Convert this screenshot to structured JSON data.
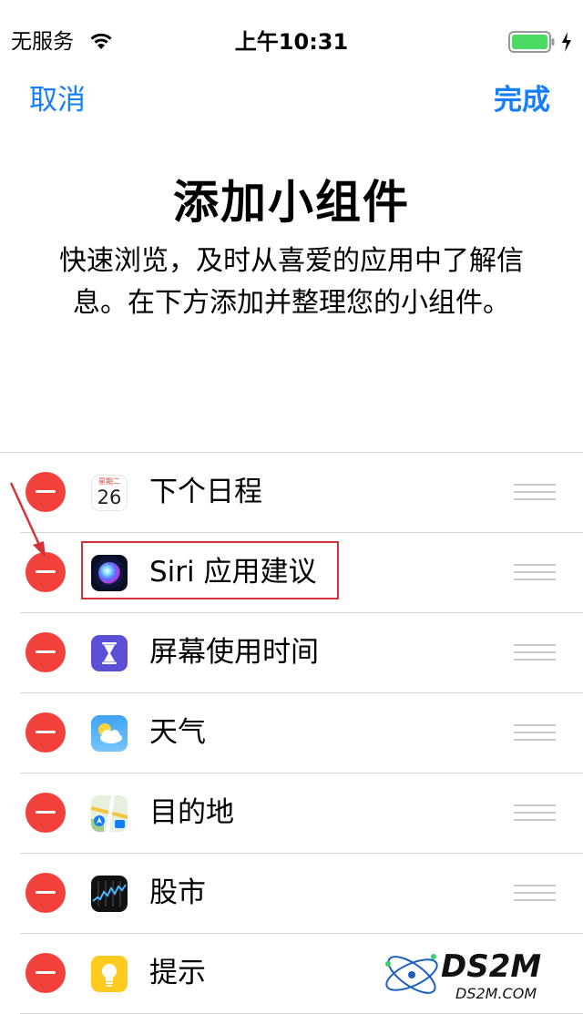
{
  "status_bar": {
    "carrier": "无服务",
    "time": "上午10:31",
    "battery_color": "#4cd964"
  },
  "nav": {
    "cancel_label": "取消",
    "done_label": "完成",
    "accent_color": "#157ffb"
  },
  "header": {
    "title": "添加小组件",
    "subtitle": "快速浏览，及时从喜爱的应用中了解信息。在下方添加并整理您的小组件。"
  },
  "widgets": [
    {
      "label": "下个日程",
      "icon": "calendar-icon",
      "calendar_weekday": "星期二",
      "calendar_date": "26"
    },
    {
      "label": "Siri 应用建议",
      "icon": "siri-icon",
      "highlighted": true
    },
    {
      "label": "屏幕使用时间",
      "icon": "screen-time-icon"
    },
    {
      "label": "天气",
      "icon": "weather-icon"
    },
    {
      "label": "目的地",
      "icon": "maps-icon"
    },
    {
      "label": "股市",
      "icon": "stocks-icon"
    },
    {
      "label": "提示",
      "icon": "tips-icon"
    }
  ],
  "remove_color": "#f2403b",
  "annotation_color": "#d6323a",
  "watermark": {
    "main": "DS2M",
    "sub": "DS2M.COM"
  }
}
